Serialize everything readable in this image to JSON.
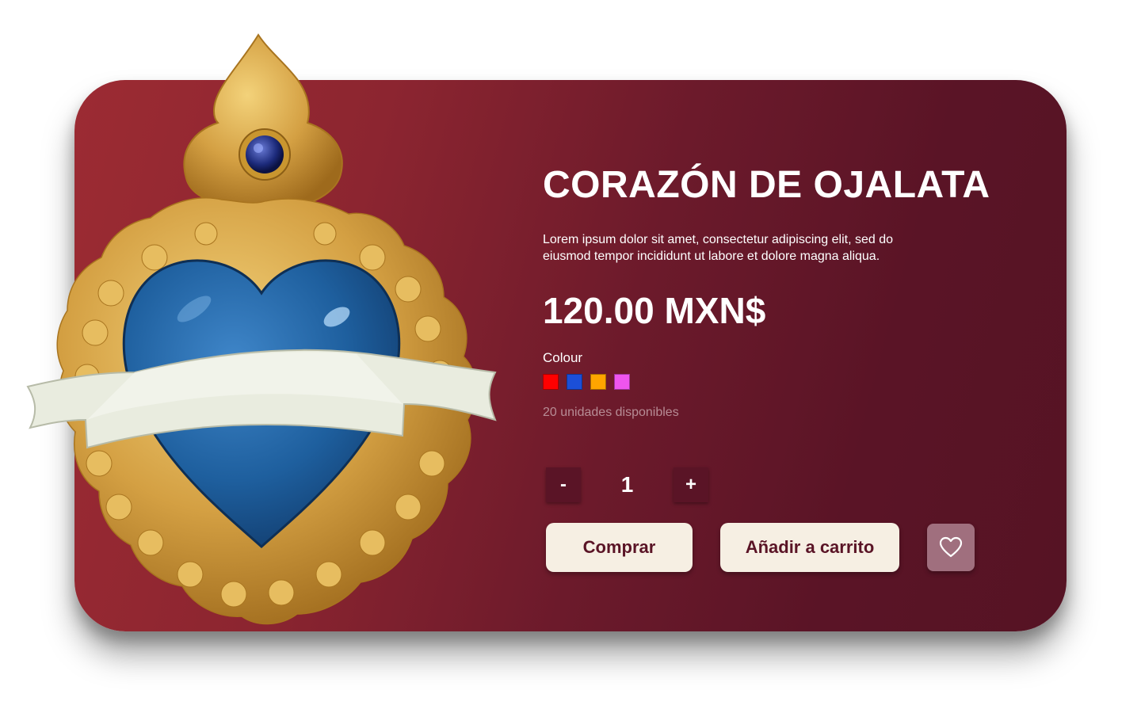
{
  "product": {
    "title": "CORAZÓN DE OJALATA",
    "description": "Lorem ipsum dolor sit amet, consectetur adipiscing elit, sed do eiusmod tempor incididunt ut labore et dolore magna aliqua.",
    "price": "120.00 MXN$",
    "colour_label": "Colour",
    "colours": [
      {
        "name": "red",
        "hex": "#ff0000"
      },
      {
        "name": "blue",
        "hex": "#1b4fd8"
      },
      {
        "name": "orange",
        "hex": "#ffa500"
      },
      {
        "name": "pink",
        "hex": "#ee55ee"
      }
    ],
    "stock": "20 unidades disponibles",
    "image_icon": "sacred-heart-tin-ornament"
  },
  "quantity": {
    "decrement_label": "-",
    "value": "1",
    "increment_label": "+"
  },
  "actions": {
    "buy_label": "Comprar",
    "add_to_cart_label": "Añadir a carrito",
    "favorite_icon": "heart-outline-icon"
  },
  "theme": {
    "card_gradient_start": "#9c2b33",
    "card_gradient_end": "#561324",
    "button_bg": "#f6efe3",
    "button_text": "#5a1426",
    "favorite_bg": "#a06f7e"
  }
}
